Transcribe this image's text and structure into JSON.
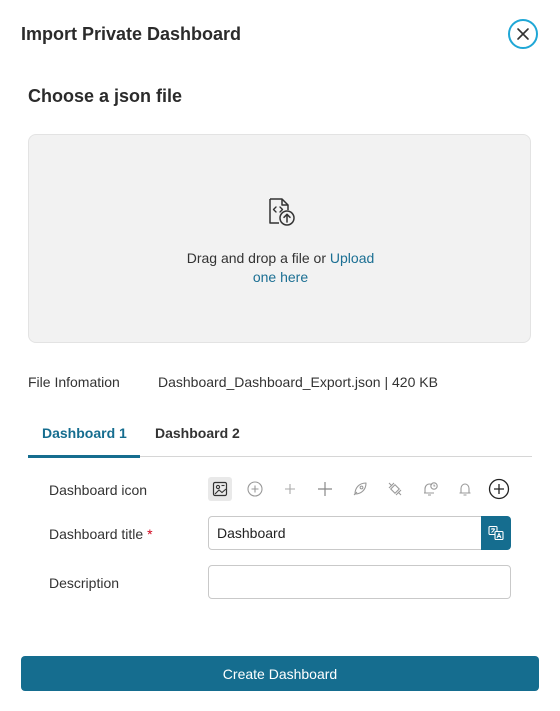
{
  "dialog": {
    "title": "Import Private Dashboard",
    "close_icon": "close-icon"
  },
  "upload": {
    "heading": "Choose a json file",
    "icon": "json-file-upload-icon",
    "drop_text": "Drag and drop a file or ",
    "upload_link": "Upload",
    "drop_text_2": "one here"
  },
  "file_info": {
    "label": "File Infomation",
    "value": "Dashboard_Dashboard_Export.json | 420 KB"
  },
  "tabs": [
    {
      "label": "Dashboard 1",
      "active": true
    },
    {
      "label": "Dashboard 2",
      "active": false
    }
  ],
  "form": {
    "icon_label": "Dashboard icon",
    "icons": [
      "dashboard-image-icon",
      "add-circle-outline-icon",
      "plus-small-icon",
      "plus-icon",
      "rocket-icon",
      "satellite-icon",
      "alarm-bell-icon",
      "bell-icon",
      "add-circle-icon"
    ],
    "selected_icon": "dashboard-image-icon",
    "title_label": "Dashboard title",
    "title_required": "*",
    "title_value": "Dashboard",
    "translate_icon": "translate-icon",
    "description_label": "Description",
    "description_value": ""
  },
  "actions": {
    "create_label": "Create Dashboard"
  },
  "colors": {
    "primary": "#156d8f",
    "close_ring": "#1fa7d6",
    "required": "#d0021b",
    "dropzone_bg": "#f2f2f2"
  }
}
